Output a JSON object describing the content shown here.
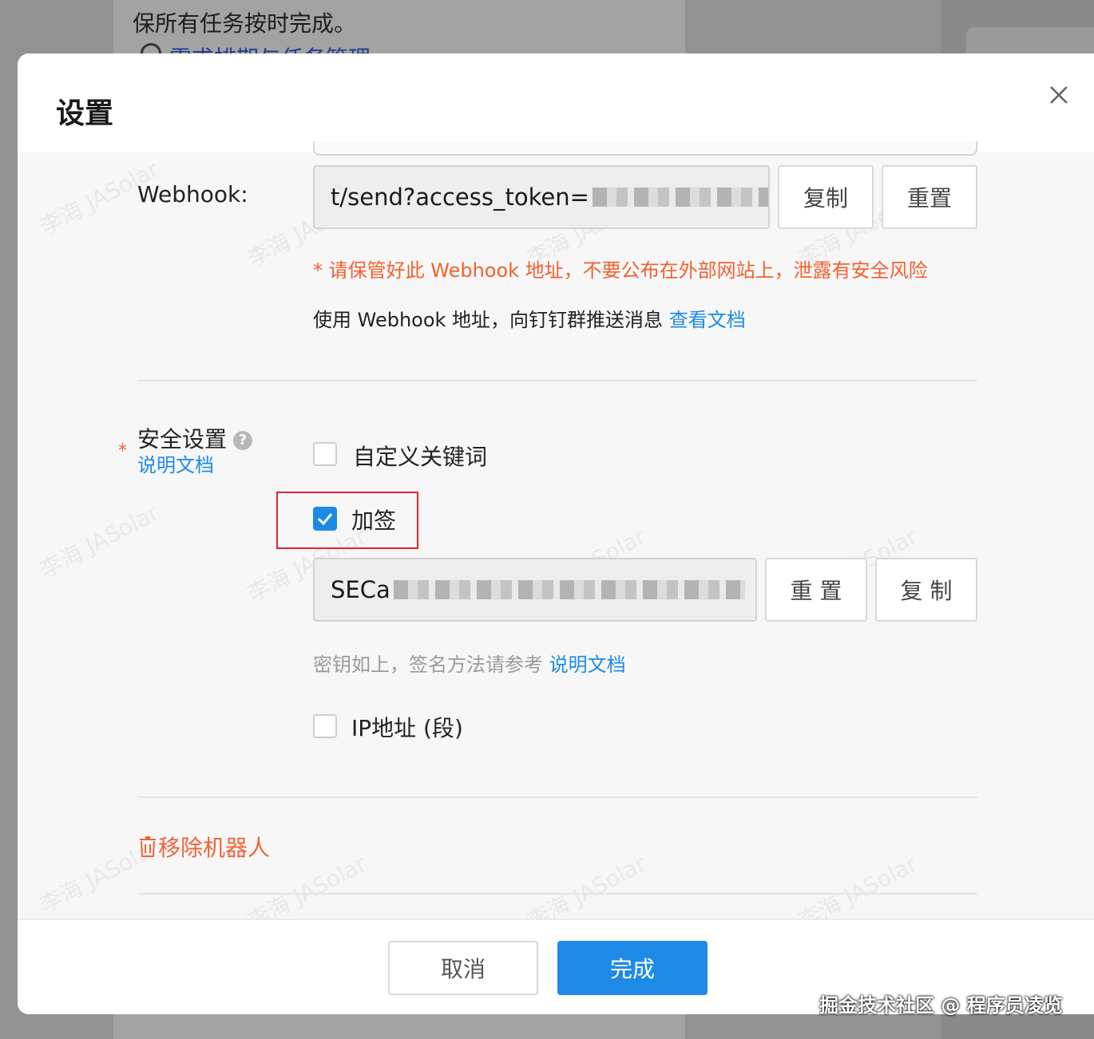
{
  "background": {
    "text_line": "保所有任务按时完成。",
    "link_line": "需求排期与任务管理"
  },
  "modal": {
    "title": "设置",
    "close_icon": "close-icon"
  },
  "webhook": {
    "label": "Webhook:",
    "value_prefix": "t/send?access_token=",
    "copy_label": "复制",
    "reset_label": "重置",
    "warning": "* 请保管好此 Webhook 地址，不要公布在外部网站上，泄露有安全风险",
    "info_text": "使用 Webhook 地址，向钉钉群推送消息",
    "docs_link": "查看文档"
  },
  "security": {
    "label": "安全设置",
    "help_icon": "question-circle-icon",
    "docs_link": "说明文档",
    "required_marker": "*",
    "options": {
      "keyword": {
        "label": "自定义关键词",
        "checked": false
      },
      "sign": {
        "label": "加签",
        "checked": true
      },
      "ip": {
        "label": "IP地址 (段)",
        "checked": false
      }
    },
    "secret_prefix": "SECa",
    "secret_reset_label": "重 置",
    "secret_copy_label": "复 制",
    "hint_text": "密钥如上，签名方法请参考",
    "hint_link": "说明文档"
  },
  "remove_robot": {
    "icon": "trash-icon",
    "label": "移除机器人"
  },
  "footer": {
    "cancel_label": "取消",
    "done_label": "完成"
  },
  "watermark_text": "李海 JASolar",
  "credit": "掘金技术社区 @ 程序员凌览",
  "colors": {
    "primary": "#1e8ae6",
    "warning": "#f2622e",
    "highlight": "#e0262a"
  }
}
